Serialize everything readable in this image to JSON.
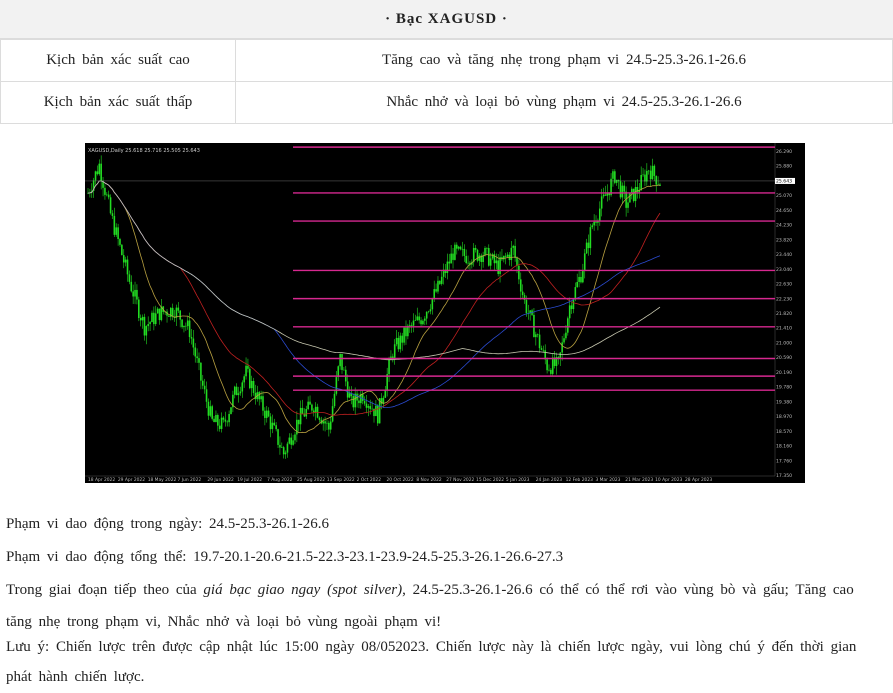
{
  "header": {
    "title": "· Bạc XAGUSD ·"
  },
  "scenarios": [
    {
      "label": "Kịch bản xác suất cao",
      "value": "Tăng cao và tăng nhẹ trong phạm vi 24.5-25.3-26.1-26.6"
    },
    {
      "label": "Kịch bản xác suất thấp",
      "value": "Nhắc nhở và loại bỏ vùng phạm vi 24.5-25.3-26.1-26.6"
    }
  ],
  "chart": {
    "info": "XAGUSD,Daily 25.618 25.716 25.505 25.643",
    "price_labels": [
      "26.290",
      "25.880",
      "25.460",
      "25.070",
      "24.650",
      "24.230",
      "23.820",
      "23.440",
      "23.040",
      "22.630",
      "22.230",
      "21.820",
      "21.410",
      "21.000",
      "20.590",
      "20.190",
      "19.780",
      "19.380",
      "18.970",
      "18.570",
      "18.160",
      "17.760",
      "17.350"
    ],
    "date_labels": [
      "18 Apr 2022",
      "29 Apr 2022",
      "18 May 2022",
      "7 Jun 2022",
      "29 Jun 2022",
      "19 Jul 2022",
      "7 Aug 2022",
      "25 Aug 2022",
      "13 Sep 2022",
      "2 Oct 2022",
      "20 Oct 2022",
      "8 Nov 2022",
      "27 Nov 2022",
      "15 Dec 2022",
      "5 Jan 2023",
      "24 Jan 2023",
      "12 Feb 2023",
      "3 Mar 2023",
      "21 Mar 2023",
      "10 Apr 2023",
      "28 Apr 2023"
    ],
    "levels": [
      26.6,
      25.3,
      24.5,
      23.1,
      22.3,
      21.5,
      20.6,
      20.1,
      19.7
    ],
    "current_price": "25.643",
    "colors": {
      "level": "#d6288f",
      "candle": "#22dd22",
      "ma_fast": "#b8a040",
      "ma_mid": "#c02020",
      "ma_slow": "#2a4ad0",
      "ma_long": "#c8c8b0"
    }
  },
  "body": {
    "intraday_label": "Phạm vi dao động trong ngày:",
    "intraday_value": "24.5-25.3-26.1-26.6",
    "overall_label": "Phạm vi dao động tổng thể:",
    "overall_value": "19.7-20.1-20.6-21.5-22.3-23.1-23.9-24.5-25.3-26.1-26.6-27.3",
    "outlook_prefix": "Trong giai đoạn tiếp theo của",
    "outlook_em": "giá bạc giao ngay (spot silver)",
    "outlook_suffix": ", 24.5-25.3-26.1-26.6 có thể có thể rơi vào vùng bò và gấu; Tăng cao tăng nhẹ trong phạm vi, Nhắc nhở và loại bỏ vùng ngoài phạm vi!",
    "note": "Lưu ý: Chiến lược trên được cập nhật lúc 15:00 ngày 08/052023. Chiến lược này là chiến lược ngày, vui lòng chú ý đến thời gian phát hành chiến lược."
  }
}
